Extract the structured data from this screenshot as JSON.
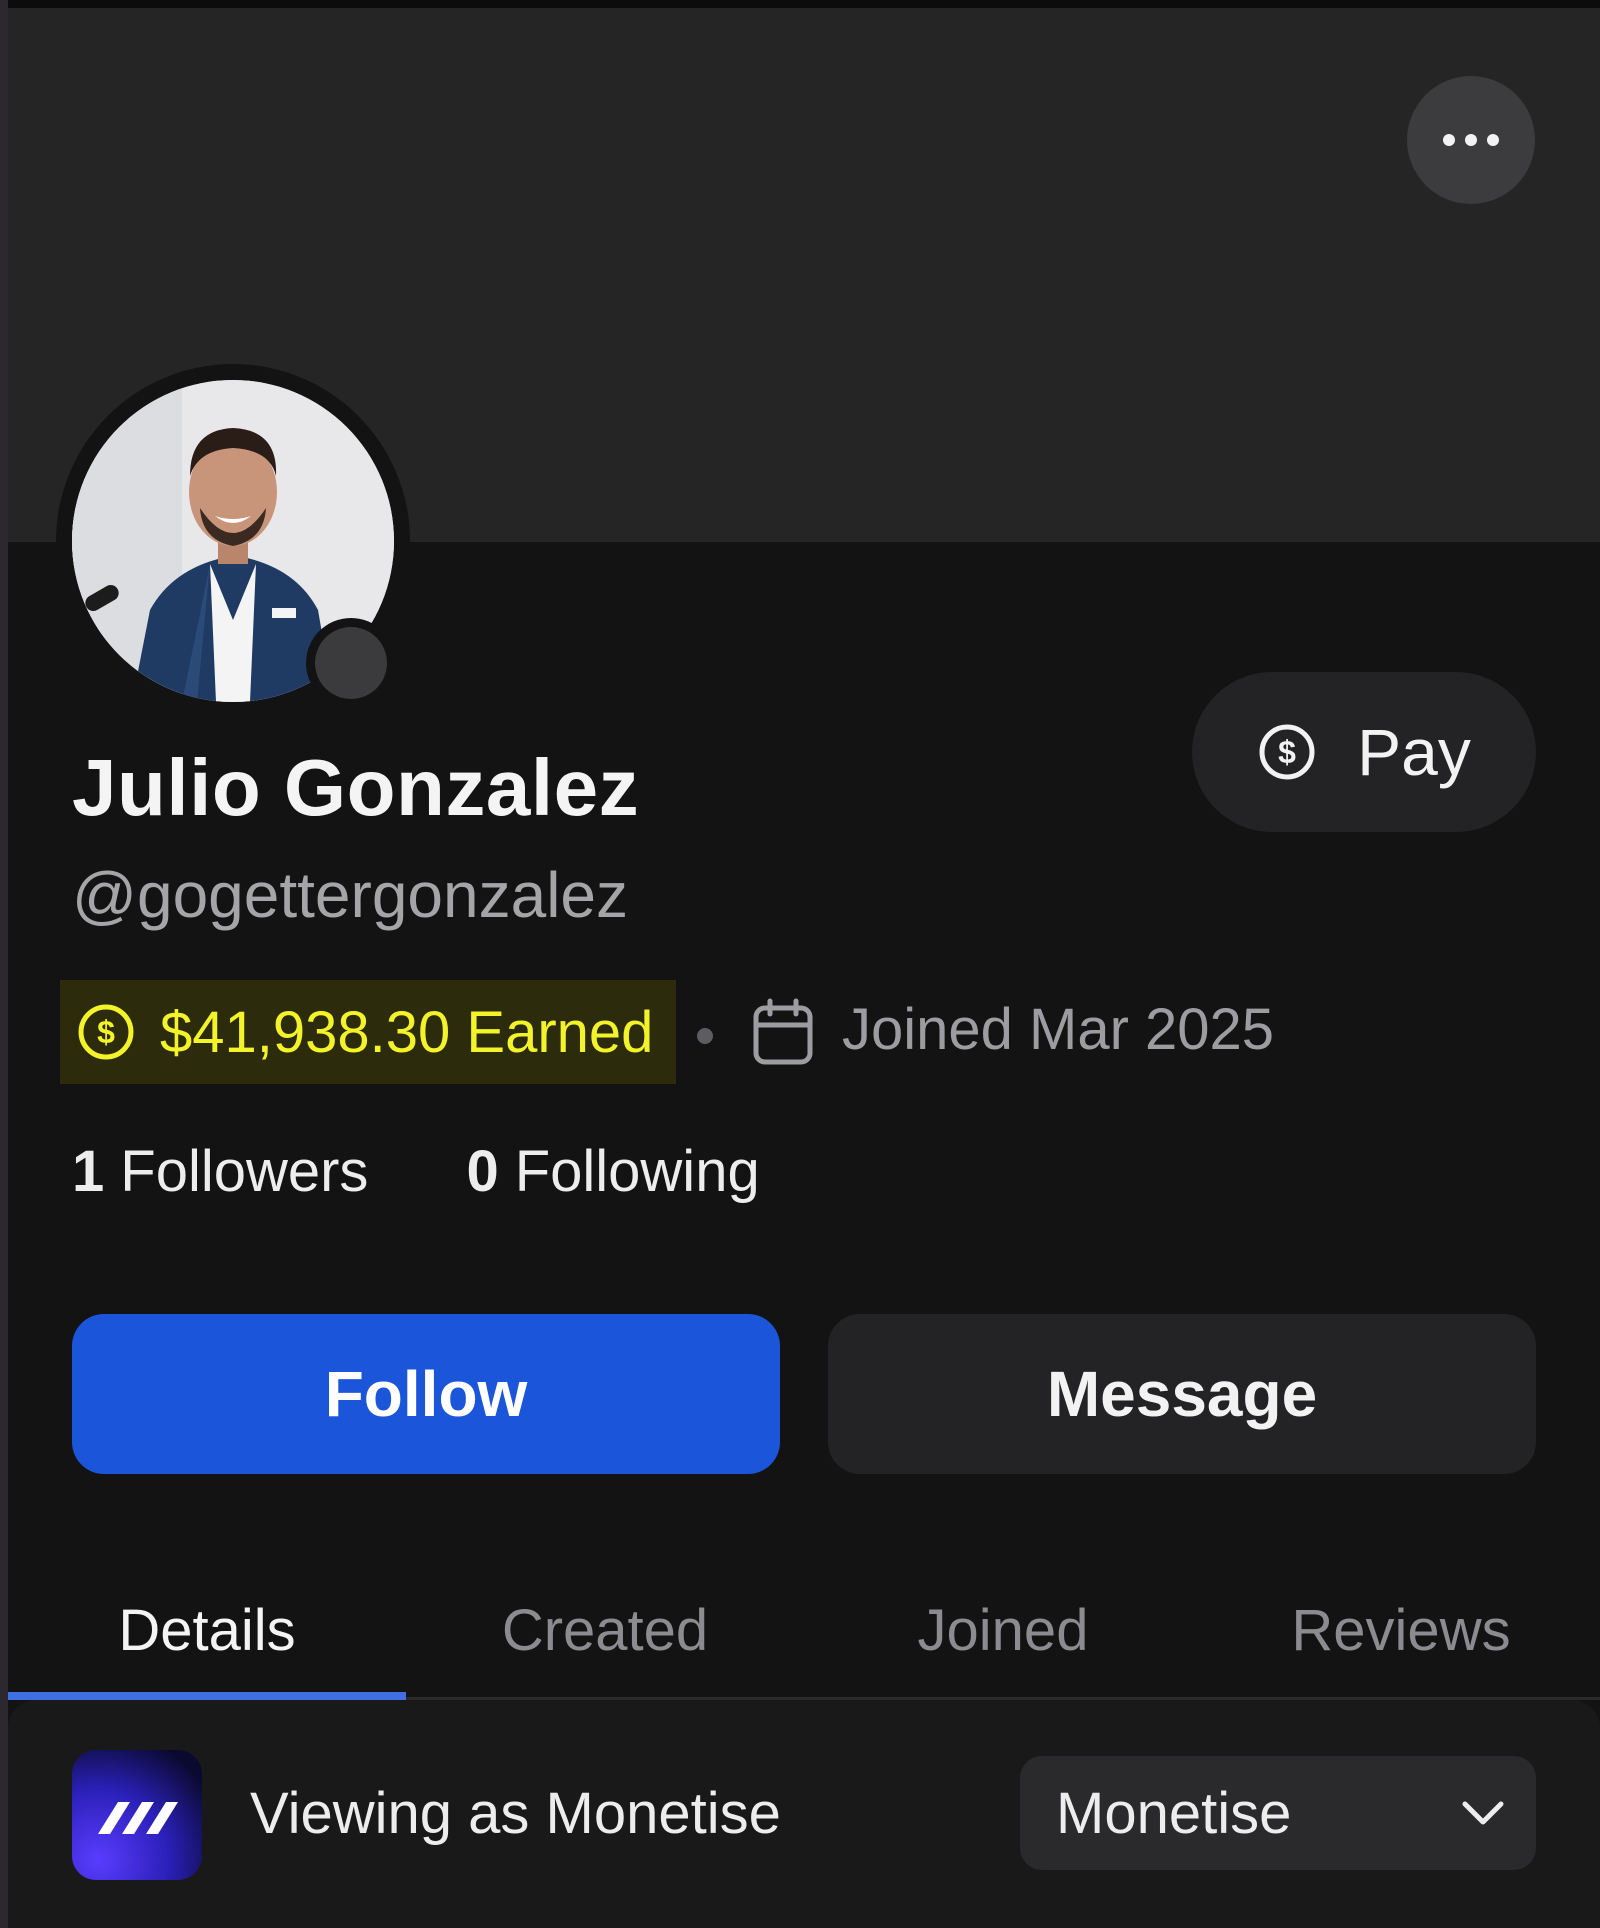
{
  "profile": {
    "name": "Julio Gonzalez",
    "handle": "@gogettergonzalez",
    "earned": "$41,938.30 Earned",
    "joined": "Joined Mar 2025",
    "followers_count": "1",
    "followers_label": "Followers",
    "following_count": "0",
    "following_label": "Following"
  },
  "actions": {
    "pay_label": "Pay",
    "follow_label": "Follow",
    "message_label": "Message"
  },
  "tabs": [
    {
      "label": "Details",
      "active": true
    },
    {
      "label": "Created",
      "active": false
    },
    {
      "label": "Joined",
      "active": false
    },
    {
      "label": "Reviews",
      "active": false
    }
  ],
  "viewing": {
    "text": "Viewing as Monetise",
    "selected": "Monetise"
  },
  "icons": {
    "more": "more-horizontal-icon",
    "pay": "dollar-circle-icon",
    "earned": "dollar-circle-icon",
    "joined": "calendar-icon",
    "dropdown": "chevron-down-icon"
  },
  "colors": {
    "background": "#131314",
    "banner": "#252526",
    "accent": "#1b56da",
    "earned_highlight": "#f3f32a",
    "active_tab_underline": "#3f6fe0"
  }
}
